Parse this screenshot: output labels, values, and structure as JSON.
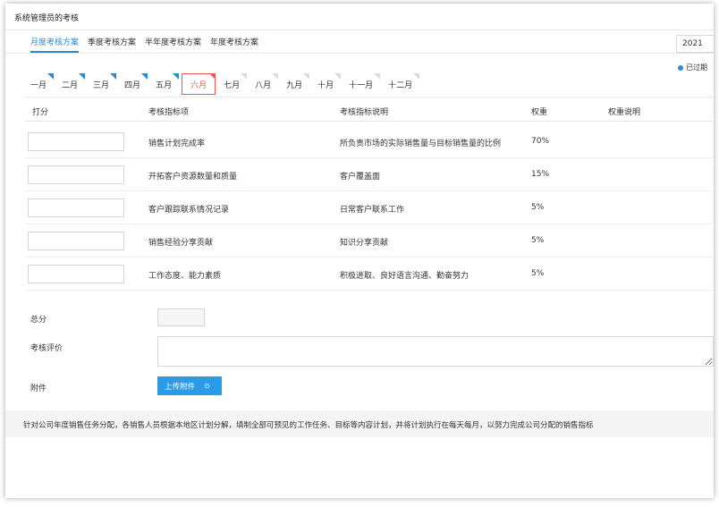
{
  "page": {
    "title": "系统管理员的考核"
  },
  "plan_tabs": [
    "月度考核方案",
    "季度考核方案",
    "半年度考核方案",
    "年度考核方案"
  ],
  "year": "2021",
  "legend": {
    "label": "已过期",
    "color": "#2a8ad6"
  },
  "months": [
    {
      "label": "一月",
      "state": "past"
    },
    {
      "label": "二月",
      "state": "past"
    },
    {
      "label": "三月",
      "state": "past"
    },
    {
      "label": "四月",
      "state": "past"
    },
    {
      "label": "五月",
      "state": "past"
    },
    {
      "label": "六月",
      "state": "current"
    },
    {
      "label": "七月",
      "state": "future"
    },
    {
      "label": "八月",
      "state": "future"
    },
    {
      "label": "九月",
      "state": "future"
    },
    {
      "label": "十月",
      "state": "future"
    },
    {
      "label": "十一月",
      "state": "future"
    },
    {
      "label": "十二月",
      "state": "future"
    }
  ],
  "table": {
    "headers": {
      "score": "打分",
      "item": "考核指标项",
      "desc": "考核指标说明",
      "weight": "权重",
      "weight_desc": "权重说明"
    },
    "rows": [
      {
        "score": "",
        "item": "销售计划完成率",
        "desc": "所负责市场的实际销售量与目标销售量的比例",
        "weight": "70%"
      },
      {
        "score": "",
        "item": "开拓客户资源数量和质量",
        "desc": "客户覆盖面",
        "weight": "15%"
      },
      {
        "score": "",
        "item": "客户跟踪联系情况记录",
        "desc": "日常客户联系工作",
        "weight": "5%"
      },
      {
        "score": "",
        "item": "销售经验分享贡献",
        "desc": "知识分享贡献",
        "weight": "5%"
      },
      {
        "score": "",
        "item": "工作态度、能力素质",
        "desc": "积极进取、良好语言沟通、勤奋努力",
        "weight": "5%"
      }
    ]
  },
  "form": {
    "total_label": "总分",
    "total_value": "",
    "comment_label": "考核评价",
    "comment_value": "",
    "attachment_label": "附件",
    "upload_label": "上传附件"
  },
  "note": "针对公司年度销售任务分配，各销售人员根据本地区计划分解，填制全部可预见的工作任务、目标等内容计划，并将计划执行在每天每月，以努力完成公司分配的销售指标",
  "colors": {
    "accent": "#2a8ad6",
    "current_month": "#e05a5a",
    "upload_button": "#2a9be6"
  }
}
